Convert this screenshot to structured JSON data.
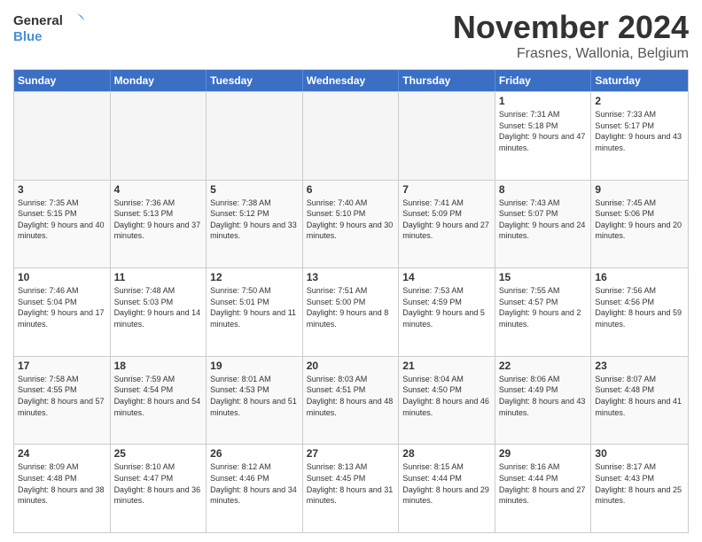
{
  "logo": {
    "line1": "General",
    "line2": "Blue"
  },
  "title": "November 2024",
  "subtitle": "Frasnes, Wallonia, Belgium",
  "weekdays": [
    "Sunday",
    "Monday",
    "Tuesday",
    "Wednesday",
    "Thursday",
    "Friday",
    "Saturday"
  ],
  "rows": [
    {
      "cells": [
        {
          "day": "",
          "empty": true
        },
        {
          "day": "",
          "empty": true
        },
        {
          "day": "",
          "empty": true
        },
        {
          "day": "",
          "empty": true
        },
        {
          "day": "",
          "empty": true
        },
        {
          "day": "1",
          "sunrise": "Sunrise: 7:31 AM",
          "sunset": "Sunset: 5:18 PM",
          "daylight": "Daylight: 9 hours and 47 minutes."
        },
        {
          "day": "2",
          "sunrise": "Sunrise: 7:33 AM",
          "sunset": "Sunset: 5:17 PM",
          "daylight": "Daylight: 9 hours and 43 minutes."
        }
      ]
    },
    {
      "cells": [
        {
          "day": "3",
          "sunrise": "Sunrise: 7:35 AM",
          "sunset": "Sunset: 5:15 PM",
          "daylight": "Daylight: 9 hours and 40 minutes."
        },
        {
          "day": "4",
          "sunrise": "Sunrise: 7:36 AM",
          "sunset": "Sunset: 5:13 PM",
          "daylight": "Daylight: 9 hours and 37 minutes."
        },
        {
          "day": "5",
          "sunrise": "Sunrise: 7:38 AM",
          "sunset": "Sunset: 5:12 PM",
          "daylight": "Daylight: 9 hours and 33 minutes."
        },
        {
          "day": "6",
          "sunrise": "Sunrise: 7:40 AM",
          "sunset": "Sunset: 5:10 PM",
          "daylight": "Daylight: 9 hours and 30 minutes."
        },
        {
          "day": "7",
          "sunrise": "Sunrise: 7:41 AM",
          "sunset": "Sunset: 5:09 PM",
          "daylight": "Daylight: 9 hours and 27 minutes."
        },
        {
          "day": "8",
          "sunrise": "Sunrise: 7:43 AM",
          "sunset": "Sunset: 5:07 PM",
          "daylight": "Daylight: 9 hours and 24 minutes."
        },
        {
          "day": "9",
          "sunrise": "Sunrise: 7:45 AM",
          "sunset": "Sunset: 5:06 PM",
          "daylight": "Daylight: 9 hours and 20 minutes."
        }
      ]
    },
    {
      "cells": [
        {
          "day": "10",
          "sunrise": "Sunrise: 7:46 AM",
          "sunset": "Sunset: 5:04 PM",
          "daylight": "Daylight: 9 hours and 17 minutes."
        },
        {
          "day": "11",
          "sunrise": "Sunrise: 7:48 AM",
          "sunset": "Sunset: 5:03 PM",
          "daylight": "Daylight: 9 hours and 14 minutes."
        },
        {
          "day": "12",
          "sunrise": "Sunrise: 7:50 AM",
          "sunset": "Sunset: 5:01 PM",
          "daylight": "Daylight: 9 hours and 11 minutes."
        },
        {
          "day": "13",
          "sunrise": "Sunrise: 7:51 AM",
          "sunset": "Sunset: 5:00 PM",
          "daylight": "Daylight: 9 hours and 8 minutes."
        },
        {
          "day": "14",
          "sunrise": "Sunrise: 7:53 AM",
          "sunset": "Sunset: 4:59 PM",
          "daylight": "Daylight: 9 hours and 5 minutes."
        },
        {
          "day": "15",
          "sunrise": "Sunrise: 7:55 AM",
          "sunset": "Sunset: 4:57 PM",
          "daylight": "Daylight: 9 hours and 2 minutes."
        },
        {
          "day": "16",
          "sunrise": "Sunrise: 7:56 AM",
          "sunset": "Sunset: 4:56 PM",
          "daylight": "Daylight: 8 hours and 59 minutes."
        }
      ]
    },
    {
      "cells": [
        {
          "day": "17",
          "sunrise": "Sunrise: 7:58 AM",
          "sunset": "Sunset: 4:55 PM",
          "daylight": "Daylight: 8 hours and 57 minutes."
        },
        {
          "day": "18",
          "sunrise": "Sunrise: 7:59 AM",
          "sunset": "Sunset: 4:54 PM",
          "daylight": "Daylight: 8 hours and 54 minutes."
        },
        {
          "day": "19",
          "sunrise": "Sunrise: 8:01 AM",
          "sunset": "Sunset: 4:53 PM",
          "daylight": "Daylight: 8 hours and 51 minutes."
        },
        {
          "day": "20",
          "sunrise": "Sunrise: 8:03 AM",
          "sunset": "Sunset: 4:51 PM",
          "daylight": "Daylight: 8 hours and 48 minutes."
        },
        {
          "day": "21",
          "sunrise": "Sunrise: 8:04 AM",
          "sunset": "Sunset: 4:50 PM",
          "daylight": "Daylight: 8 hours and 46 minutes."
        },
        {
          "day": "22",
          "sunrise": "Sunrise: 8:06 AM",
          "sunset": "Sunset: 4:49 PM",
          "daylight": "Daylight: 8 hours and 43 minutes."
        },
        {
          "day": "23",
          "sunrise": "Sunrise: 8:07 AM",
          "sunset": "Sunset: 4:48 PM",
          "daylight": "Daylight: 8 hours and 41 minutes."
        }
      ]
    },
    {
      "cells": [
        {
          "day": "24",
          "sunrise": "Sunrise: 8:09 AM",
          "sunset": "Sunset: 4:48 PM",
          "daylight": "Daylight: 8 hours and 38 minutes."
        },
        {
          "day": "25",
          "sunrise": "Sunrise: 8:10 AM",
          "sunset": "Sunset: 4:47 PM",
          "daylight": "Daylight: 8 hours and 36 minutes."
        },
        {
          "day": "26",
          "sunrise": "Sunrise: 8:12 AM",
          "sunset": "Sunset: 4:46 PM",
          "daylight": "Daylight: 8 hours and 34 minutes."
        },
        {
          "day": "27",
          "sunrise": "Sunrise: 8:13 AM",
          "sunset": "Sunset: 4:45 PM",
          "daylight": "Daylight: 8 hours and 31 minutes."
        },
        {
          "day": "28",
          "sunrise": "Sunrise: 8:15 AM",
          "sunset": "Sunset: 4:44 PM",
          "daylight": "Daylight: 8 hours and 29 minutes."
        },
        {
          "day": "29",
          "sunrise": "Sunrise: 8:16 AM",
          "sunset": "Sunset: 4:44 PM",
          "daylight": "Daylight: 8 hours and 27 minutes."
        },
        {
          "day": "30",
          "sunrise": "Sunrise: 8:17 AM",
          "sunset": "Sunset: 4:43 PM",
          "daylight": "Daylight: 8 hours and 25 minutes."
        }
      ]
    }
  ]
}
